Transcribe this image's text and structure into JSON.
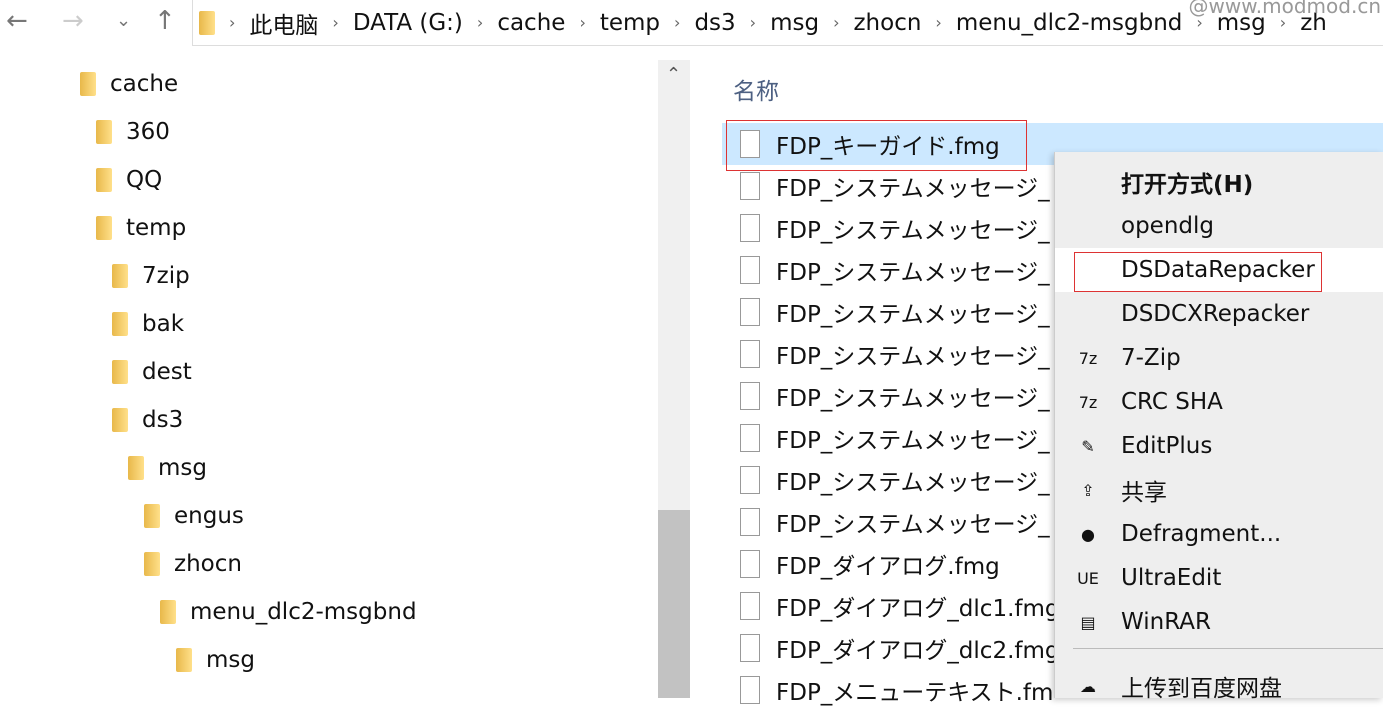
{
  "nav": {
    "back": "←",
    "forward": "→",
    "recent": "⌄",
    "up": "↑"
  },
  "breadcrumb": [
    "此电脑",
    "DATA (G:)",
    "cache",
    "temp",
    "ds3",
    "msg",
    "zhocn",
    "menu_dlc2-msgbnd",
    "msg",
    "zh"
  ],
  "watermark": "@www.modmod.cn",
  "tree": [
    {
      "label": "cache",
      "level": 0
    },
    {
      "label": "360",
      "level": 1
    },
    {
      "label": "QQ",
      "level": 1
    },
    {
      "label": "temp",
      "level": 1
    },
    {
      "label": "7zip",
      "level": 2
    },
    {
      "label": "bak",
      "level": 2
    },
    {
      "label": "dest",
      "level": 2
    },
    {
      "label": "ds3",
      "level": 2
    },
    {
      "label": "msg",
      "level": 3
    },
    {
      "label": "engus",
      "level": 4
    },
    {
      "label": "zhocn",
      "level": 4
    },
    {
      "label": "menu_dlc2-msgbnd",
      "level": 5
    },
    {
      "label": "msg",
      "level": 6
    }
  ],
  "list": {
    "header": "名称",
    "files": [
      "FDP_キーガイド.fmg",
      "FDP_システムメッセージ_",
      "FDP_システムメッセージ_",
      "FDP_システムメッセージ_",
      "FDP_システムメッセージ_",
      "FDP_システムメッセージ_",
      "FDP_システムメッセージ_",
      "FDP_システムメッセージ_",
      "FDP_システムメッセージ_",
      "FDP_システムメッセージ_",
      "FDP_ダイアログ.fmg",
      "FDP_ダイアログ_dlc1.fmg",
      "FDP_ダイアログ_dlc2.fmg",
      "FDP_メニューテキスト.fm"
    ],
    "selected": 0
  },
  "menu": {
    "items": [
      {
        "label": "打开方式(H)",
        "icon": "",
        "bold": true
      },
      {
        "label": "opendlg",
        "icon": ""
      },
      {
        "label": "DSDataRepacker",
        "icon": "",
        "highlighted": true
      },
      {
        "label": "DSDCXRepacker",
        "icon": ""
      },
      {
        "label": "7-Zip",
        "icon": "7z"
      },
      {
        "label": "CRC SHA",
        "icon": "7z"
      },
      {
        "label": "EditPlus",
        "icon": "✎"
      },
      {
        "label": "共享",
        "icon": "⇪"
      },
      {
        "label": "Defragment...",
        "icon": "●"
      },
      {
        "label": "UltraEdit",
        "icon": "UE"
      },
      {
        "label": "WinRAR",
        "icon": "▤"
      },
      {
        "label": "上传到百度网盘",
        "icon": "☁"
      }
    ]
  },
  "colors": {
    "selection": "#cce8ff",
    "highlight_box": "#dd3333",
    "folder": "#f4c95d"
  }
}
